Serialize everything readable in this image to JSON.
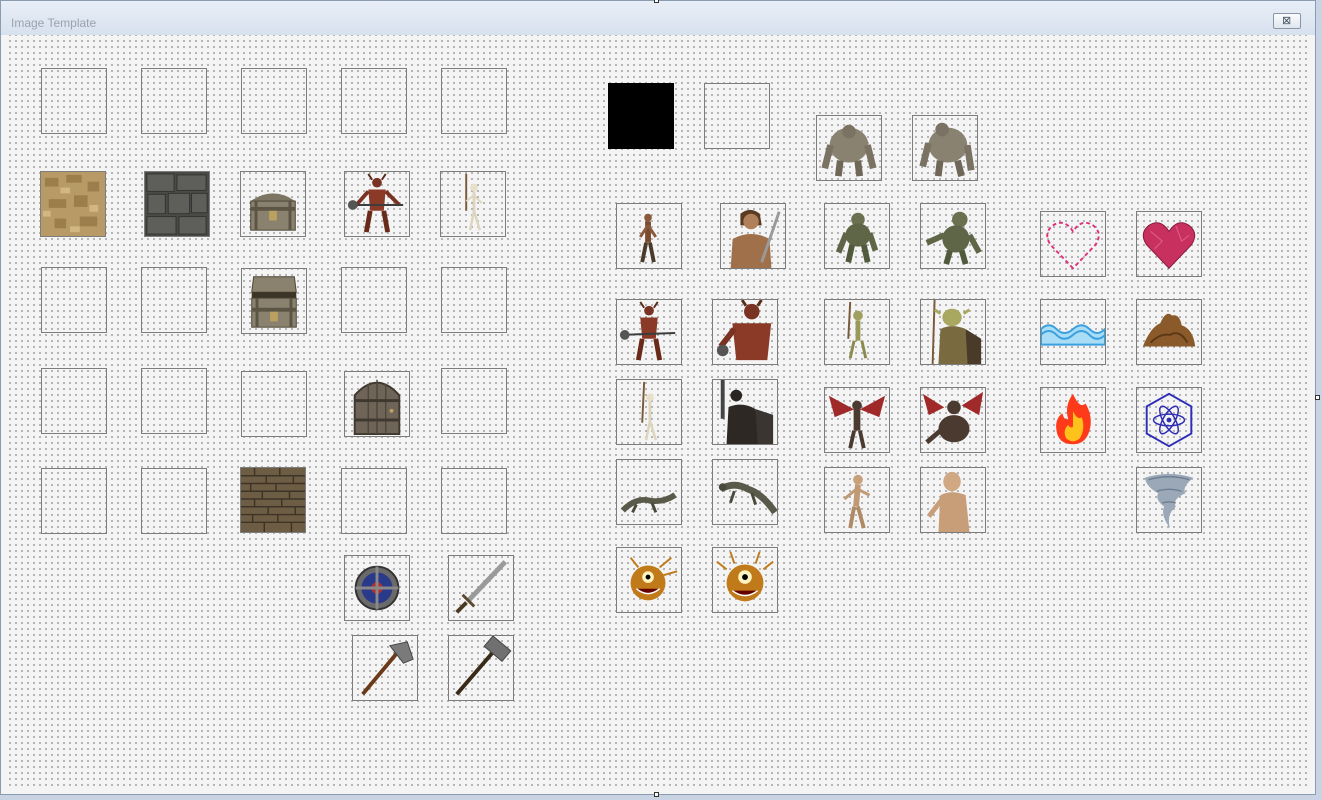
{
  "window": {
    "title": "Image Template",
    "close_glyph": "⊠"
  },
  "slots": {
    "empty": "empty-slot",
    "black": "black-image",
    "sand_texture": "sand-texture",
    "stone_texture": "stone-texture",
    "chest_closed": "treasure-chest-icon",
    "chest_open": "open-chest-icon",
    "minotaur": "minotaur-icon",
    "skeleton": "skeleton-icon",
    "wooden_door": "wooden-door-icon",
    "brick_wall": "brick-wall-texture",
    "shield": "shield-icon",
    "sword": "sword-icon",
    "axe": "axe-icon",
    "hammer": "hammer-icon",
    "golem": "stone-golem-icon",
    "warrior": "warrior-icon",
    "troll": "troll-icon",
    "goblin": "goblin-icon",
    "heart_outline": "heart-outline-icon",
    "heart_filled": "heart-filled-icon",
    "water": "water-icon",
    "earth": "earth-pile-icon",
    "dark_knight": "dark-knight-icon",
    "demon": "winged-demon-icon",
    "fire": "fire-icon",
    "atom": "atom-icon",
    "lizard": "lizard-icon",
    "ghoul": "ghoul-icon",
    "tornado": "tornado-icon",
    "beholder": "beholder-icon"
  },
  "colors": {
    "heart_outline": "#e0307a",
    "heart_fill": "#c8305f",
    "water": "#3aa0e0",
    "fire": "#ff3a1a",
    "atom": "#2d2db5"
  }
}
